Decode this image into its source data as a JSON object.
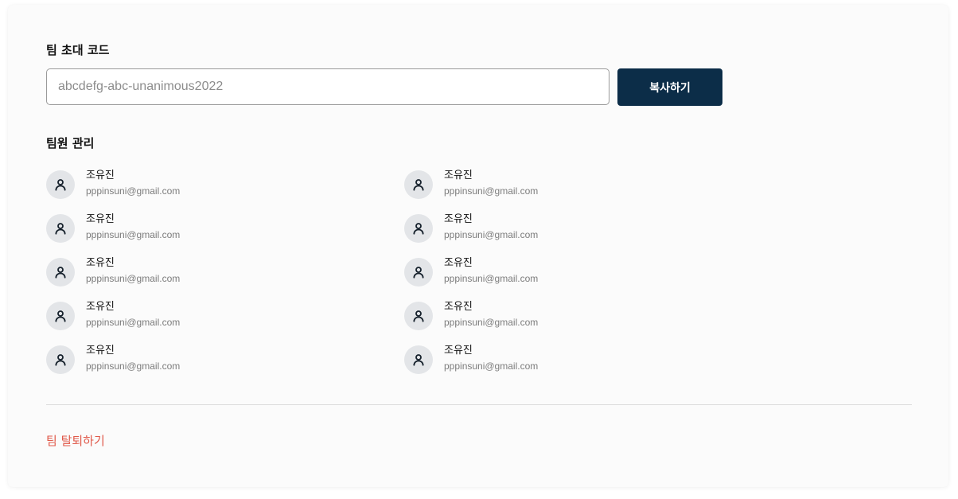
{
  "invite": {
    "title": "팀 초대 코드",
    "code_placeholder": "abcdefg-abc-unanimous2022",
    "copy_label": "복사하기"
  },
  "members": {
    "title": "팀원 관리",
    "items": [
      {
        "name": "조유진",
        "email": "pppinsuni@gmail.com"
      },
      {
        "name": "조유진",
        "email": "pppinsuni@gmail.com"
      },
      {
        "name": "조유진",
        "email": "pppinsuni@gmail.com"
      },
      {
        "name": "조유진",
        "email": "pppinsuni@gmail.com"
      },
      {
        "name": "조유진",
        "email": "pppinsuni@gmail.com"
      },
      {
        "name": "조유진",
        "email": "pppinsuni@gmail.com"
      },
      {
        "name": "조유진",
        "email": "pppinsuni@gmail.com"
      },
      {
        "name": "조유진",
        "email": "pppinsuni@gmail.com"
      },
      {
        "name": "조유진",
        "email": "pppinsuni@gmail.com"
      },
      {
        "name": "조유진",
        "email": "pppinsuni@gmail.com"
      }
    ],
    "avatar_icon": "user-icon"
  },
  "leave": {
    "label": "팀 탈퇴하기"
  },
  "colors": {
    "primary_button": "#0c2d48",
    "danger_text": "#e05a4b",
    "avatar_bg": "#e3e5e8"
  }
}
